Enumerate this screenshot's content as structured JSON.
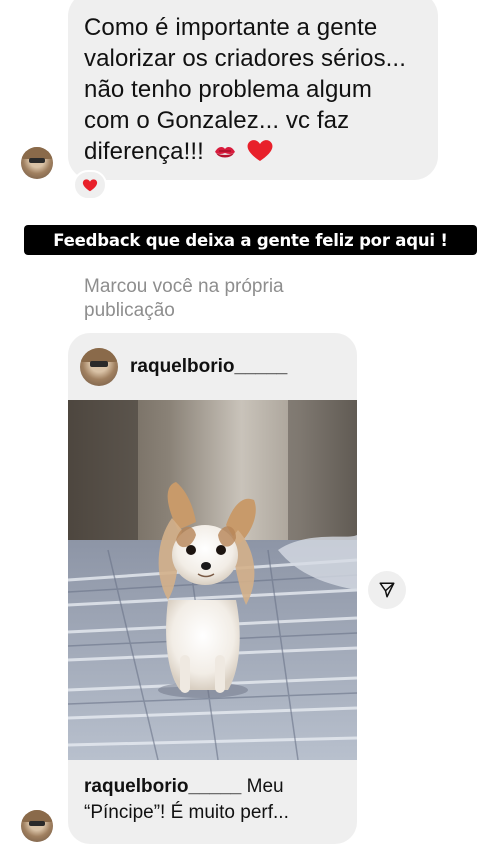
{
  "message": {
    "text": "Como é importante a gente valorizar os criadores sérios... não tenho problema algum com o Gonzalez... vc faz diferença!!!",
    "emoji_1": "kiss-mark-icon",
    "emoji_2": "red-heart-icon",
    "reaction": "red-heart-icon"
  },
  "banner": {
    "text": "Feedback que deixa a gente feliz por aqui !"
  },
  "mention": {
    "text": "Marcou você na própria publicação"
  },
  "post": {
    "username": "raquelborio_____",
    "caption_user": "raquelborio_____",
    "caption_text": " Meu “Píncipe”! É muito perf..."
  },
  "colors": {
    "bubble": "#efefef",
    "banner_bg": "#000000",
    "muted_text": "#8e8e8e",
    "heart": "#e8202a"
  }
}
